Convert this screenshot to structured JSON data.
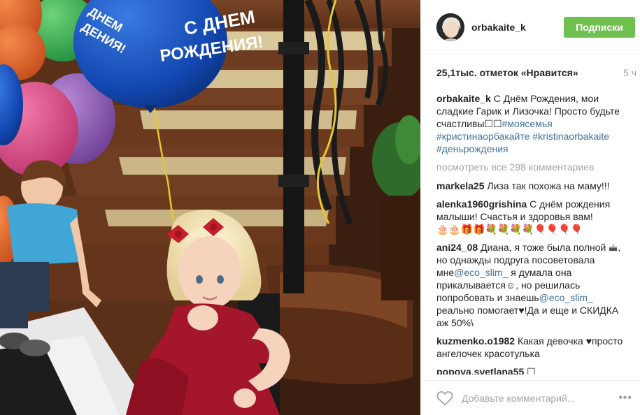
{
  "post": {
    "username": "orbakaite_k",
    "follow_label": "Подписки",
    "likes": "25,1тыс. отметок «Нравится»",
    "time": "5 ч",
    "photo_balloon_text_1": "С ДНЕМ",
    "photo_balloon_text_2": "РОЖДЕНИЯ!",
    "caption": {
      "user": "orbakaite_k",
      "text": "С Днём Рождения, мои сладкие Гарик и Лизочка! Просто будьте счастливы",
      "emoji": "☐☐",
      "tags": [
        "#моясемья",
        "#кристинаорбакайте",
        "#kristinaorbakaite",
        "#деньрождения"
      ]
    },
    "view_all": "посмотреть все 298 комментариев",
    "comments": [
      {
        "user": "markela25",
        "text": "Лиза так похожа на маму!!!"
      },
      {
        "user": "alenka1960grishina",
        "text": "С днём рождения малыши! Счастья и здоровья вам!",
        "emoji": "🎂🎂🎁🎁💐💐💐💐🎈🎈🎈🎈"
      },
      {
        "user": "ani24_08",
        "text_1": "Диана, я тоже была полной",
        "text_2": ", но однажды подруга посоветовала мне",
        "tag_1": "@eco_slim_",
        "text_3": " я думала она прикалывается",
        "text_4": ", но решилась попробовать и знаешь",
        "tag_2": "@eco_slim_",
        "text_5": " реально помогает",
        "text_6": "!Да и еще и СКИДКА аж 50%\\"
      },
      {
        "user": "kuzmenko.o1982",
        "text": "Какая девочка",
        "text_2": "просто ангелочек красотулька"
      },
      {
        "user": "popova.svetlana55",
        "text": "☐"
      }
    ],
    "comment_placeholder": "Добавьте комментарий...",
    "more": "•••"
  },
  "colors": {
    "follow": "#70c050",
    "tag": "#3f729b",
    "muted": "#a5a5a5",
    "text": "#262626"
  },
  "icons": {
    "like": "heart-icon",
    "more": "more-dots-icon"
  }
}
